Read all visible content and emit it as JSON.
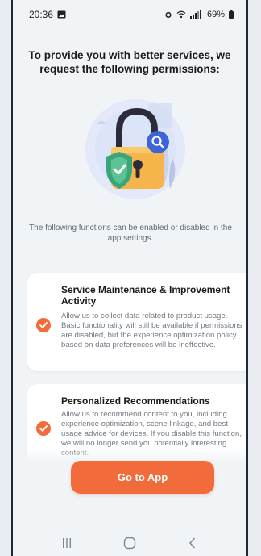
{
  "status_bar": {
    "time": "20:36",
    "battery": "69%",
    "icons": [
      "gallery-icon",
      "alarm-icon",
      "wifi-icon",
      "signal-icon",
      "battery-icon"
    ]
  },
  "title": "To provide you with better services, we request the following permissions:",
  "subnote": "The following functions can be enabled or disabled in the app settings.",
  "cards": [
    {
      "title": "Service Maintenance & Improvement Activity",
      "description": "Allow us to collect data related to product usage. Basic functionality will still be available if permissions are disabled, but the experience optimization policy based on data preferences will be ineffective.",
      "checked": true
    },
    {
      "title": "Personalized Recommendations",
      "description": "Allow us to recommend content to you, including experience optimization, scene linkage, and best usage advice for devices. If you disable this function, we will no longer send you potentially interesting content.",
      "checked": true
    }
  ],
  "primary_button": "Go to App",
  "colors": {
    "accent": "#f26b3a",
    "background": "#f1f4f7",
    "card": "#ffffff",
    "lock_body": "#f6b54a",
    "shield": "#3aa57a",
    "search_badge": "#3f63d8"
  },
  "nav_bar": [
    "recent-apps-icon",
    "home-icon",
    "back-icon"
  ]
}
